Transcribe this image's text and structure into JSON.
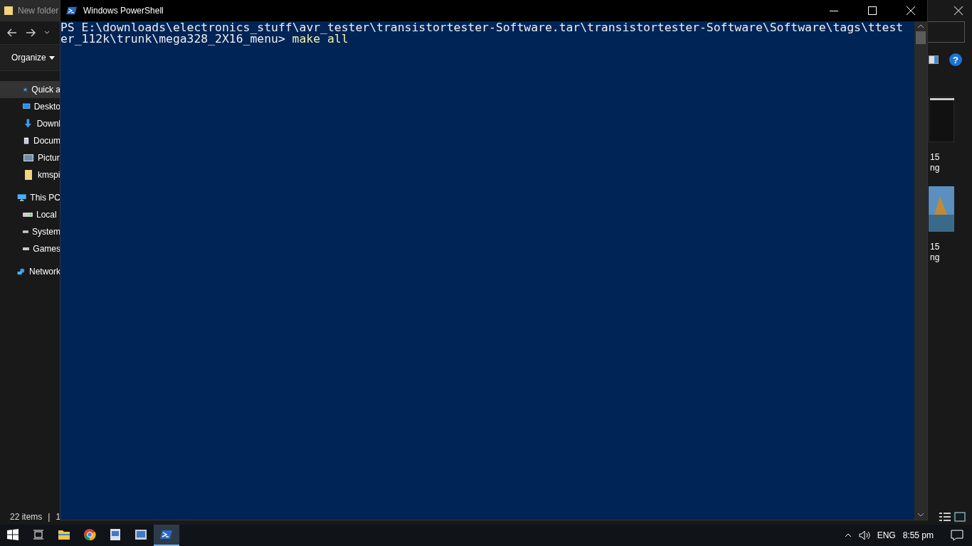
{
  "explorer": {
    "title": "New folder",
    "organize": "Organize",
    "sidebar": [
      {
        "label": "Quick a",
        "kind": "star",
        "selected": true
      },
      {
        "label": "Deskto",
        "kind": "desktop",
        "selected": false
      },
      {
        "label": "Downl",
        "kind": "download",
        "selected": false
      },
      {
        "label": "Docum",
        "kind": "document",
        "selected": false
      },
      {
        "label": "Pictur",
        "kind": "picture",
        "selected": false
      },
      {
        "label": "kmspi",
        "kind": "folder",
        "selected": false
      },
      {
        "label": "This PC",
        "kind": "pc",
        "selected": false
      },
      {
        "label": "Local",
        "kind": "disk",
        "selected": false
      },
      {
        "label": "System",
        "kind": "disk",
        "selected": false
      },
      {
        "label": "Games",
        "kind": "disk",
        "selected": false
      },
      {
        "label": "Network",
        "kind": "network",
        "selected": false
      }
    ],
    "thumbnails": [
      {
        "kind": "screenshot",
        "caption": [
          "15",
          "ng"
        ]
      },
      {
        "kind": "landscape",
        "caption": [
          "15",
          "ng"
        ]
      }
    ],
    "help": "?",
    "status": {
      "count": "22 items",
      "separator": "|",
      "selected": "1"
    }
  },
  "powershell": {
    "title": "Windows PowerShell",
    "lines": [
      "PS E:\\downloads\\electronics_stuff\\avr_tester\\transistortester-Software.tar\\transistortester-Software\\Software\\tags\\ttest"
    ],
    "prompt": "er_112k\\trunk\\mega328_2X16_menu>",
    "command": "make all"
  },
  "taskbar": {
    "apps": [
      {
        "kind": "explorer",
        "active": false
      },
      {
        "kind": "chrome",
        "active": false
      },
      {
        "kind": "viewer",
        "active": false
      },
      {
        "kind": "photos",
        "active": false
      },
      {
        "kind": "powershell",
        "active": true
      }
    ],
    "language": "ENG",
    "time": "8:55 pm"
  }
}
